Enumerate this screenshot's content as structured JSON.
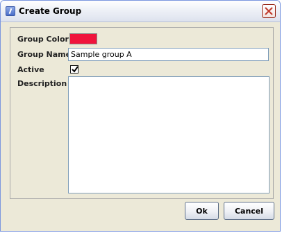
{
  "window": {
    "title": "Create Group",
    "icon": "app-icon"
  },
  "form": {
    "group_color_label": "Group Color",
    "group_color_value": "#f0143c",
    "group_name_label": "Group Name",
    "group_name_value": "Sample group A",
    "active_label": "Active",
    "active_checked": true,
    "description_label": "Description",
    "description_value": ""
  },
  "buttons": {
    "ok_label": "Ok",
    "cancel_label": "Cancel"
  },
  "icons": {
    "close": "close-icon",
    "check": "checkmark-icon"
  }
}
